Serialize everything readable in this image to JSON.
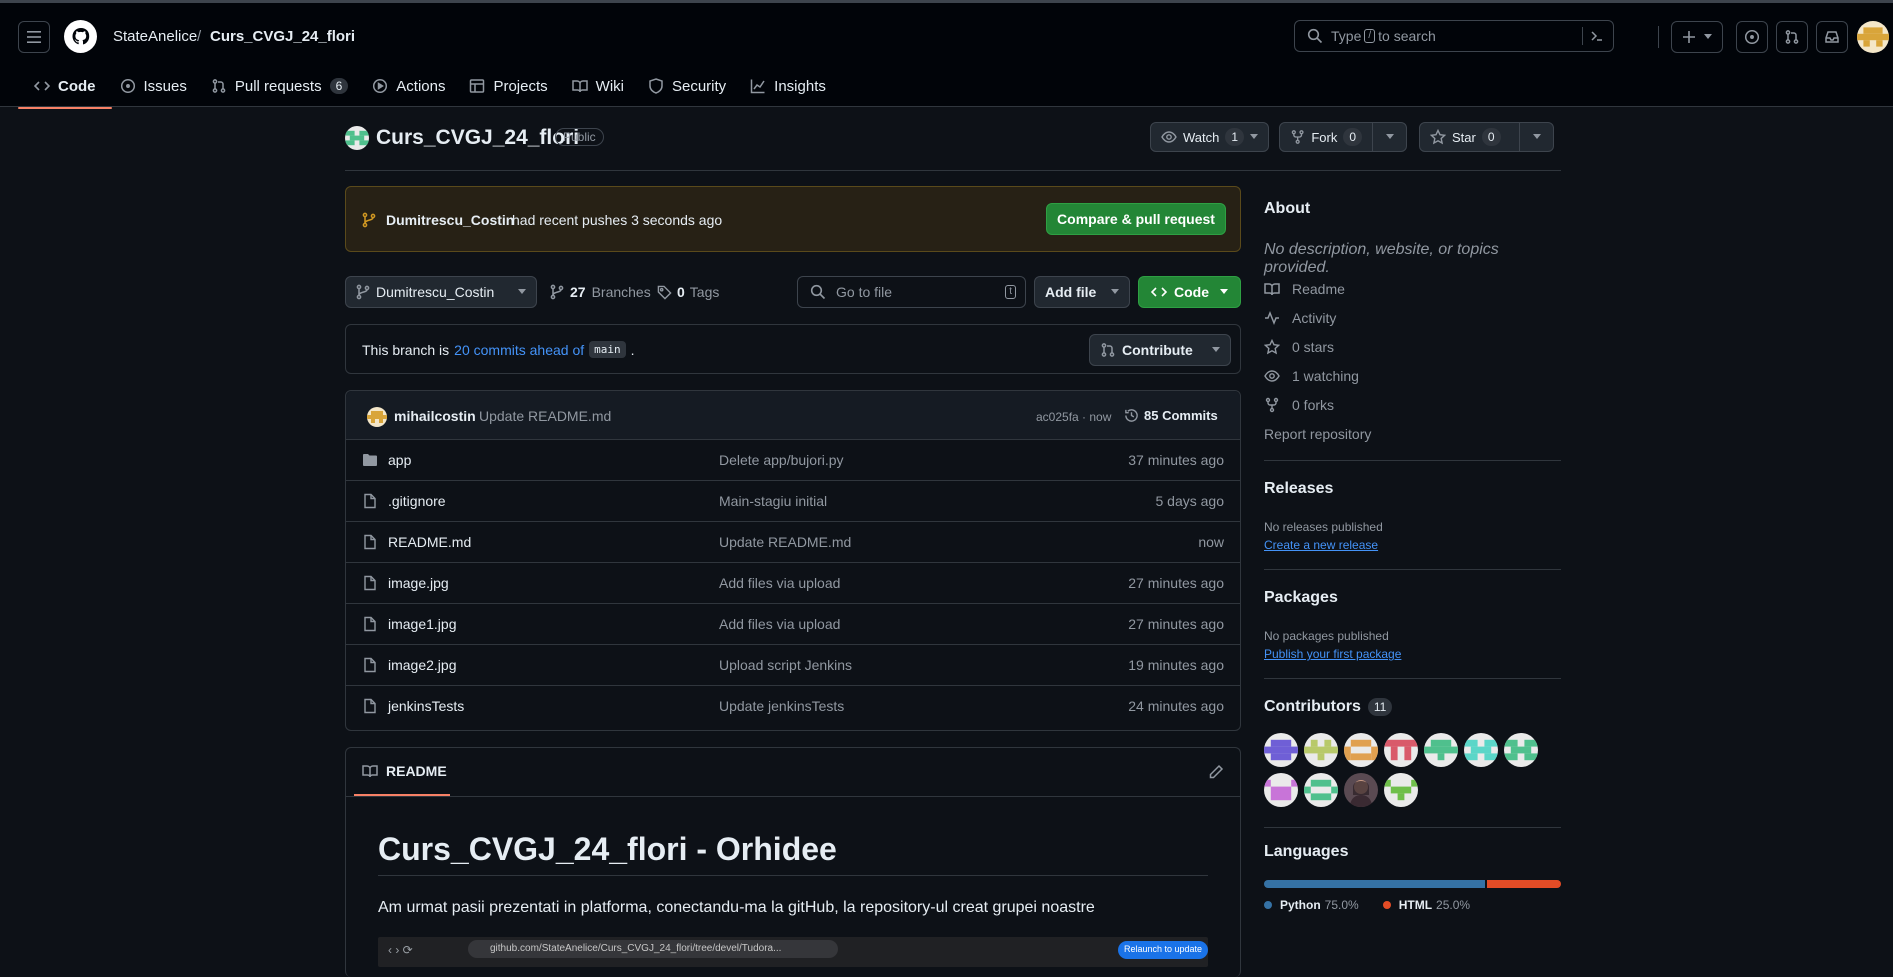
{
  "header": {
    "owner": "StateAnelice",
    "separator": "/",
    "repo": "Curs_CVGJ_24_flori",
    "search_placeholder_prefix": "Type",
    "search_key": "/",
    "search_placeholder_suffix": "to search"
  },
  "tabs": [
    {
      "label": "Code"
    },
    {
      "label": "Issues"
    },
    {
      "label": "Pull requests",
      "count": "6"
    },
    {
      "label": "Actions"
    },
    {
      "label": "Projects"
    },
    {
      "label": "Wiki"
    },
    {
      "label": "Security"
    },
    {
      "label": "Insights"
    }
  ],
  "repo": {
    "name": "Curs_CVGJ_24_flori",
    "visibility": "Public",
    "watch_label": "Watch",
    "watch_count": "1",
    "fork_label": "Fork",
    "fork_count": "0",
    "star_label": "Star",
    "star_count": "0"
  },
  "banner": {
    "user": "Dumitrescu_Costin",
    "text": "had recent pushes 3 seconds ago",
    "button": "Compare & pull request"
  },
  "toolbar": {
    "branch": "Dumitrescu_Costin",
    "branches_count": "27",
    "branches_label": "Branches",
    "tags_count": "0",
    "tags_label": "Tags",
    "goto_placeholder": "Go to file",
    "goto_key": "t",
    "add_file": "Add file",
    "code": "Code"
  },
  "ahead": {
    "prefix": "This branch is",
    "link": "20 commits ahead of",
    "base": "main",
    "suffix": ".",
    "contribute": "Contribute"
  },
  "commit": {
    "author": "mihailcostin",
    "message": "Update README.md",
    "hash": "ac025fa · now",
    "commits": "85 Commits"
  },
  "files": [
    {
      "name": "app",
      "type": "folder",
      "message": "Delete app/bujori.py",
      "age": "37 minutes ago"
    },
    {
      "name": ".gitignore",
      "type": "file",
      "message": "Main-stagiu initial",
      "age": "5 days ago"
    },
    {
      "name": "README.md",
      "type": "file",
      "message": "Update README.md",
      "age": "now"
    },
    {
      "name": "image.jpg",
      "type": "file",
      "message": "Add files via upload",
      "age": "27 minutes ago"
    },
    {
      "name": "image1.jpg",
      "type": "file",
      "message": "Add files via upload",
      "age": "27 minutes ago"
    },
    {
      "name": "image2.jpg",
      "type": "file",
      "message": "Upload script Jenkins",
      "age": "19 minutes ago"
    },
    {
      "name": "jenkinsTests",
      "type": "file",
      "message": "Update jenkinsTests",
      "age": "24 minutes ago"
    }
  ],
  "readme": {
    "tab": "README",
    "title": "Curs_CVGJ_24_flori - Orhidee",
    "text": "Am urmat pasii prezentati in platforma, conectandu-ma la gitHub, la repository-ul creat grupei noastre",
    "screenshot_url": "github.com/StateAnelice/Curs_CVGJ_24_flori/tree/devel/Tudora...",
    "screenshot_button": "Relaunch to update"
  },
  "about": {
    "heading": "About",
    "description": "No description, website, or topics provided.",
    "readme": "Readme",
    "activity": "Activity",
    "stars": "0 stars",
    "watching": "1 watching",
    "forks": "0 forks",
    "report": "Report repository"
  },
  "releases": {
    "heading": "Releases",
    "text": "No releases published",
    "link": "Create a new release"
  },
  "packages": {
    "heading": "Packages",
    "text": "No packages published",
    "link": "Publish your first package"
  },
  "contributors": {
    "heading": "Contributors",
    "count": "11"
  },
  "languages": {
    "heading": "Languages",
    "items": [
      {
        "name": "Python",
        "percent": "75.0%",
        "value": 75,
        "color": "#3572A5"
      },
      {
        "name": "HTML",
        "percent": "25.0%",
        "value": 25,
        "color": "#e34c26"
      }
    ]
  }
}
